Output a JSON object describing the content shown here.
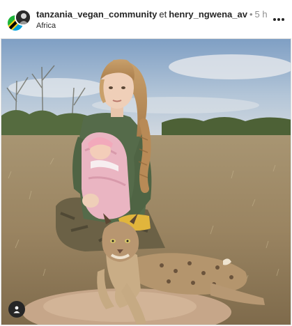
{
  "post": {
    "author_primary": "tanzania_vegan_community",
    "author_joiner": "et",
    "author_secondary": "henry_ngwena_av",
    "separator": "•",
    "age": "5 h",
    "location": "Africa"
  },
  "icons": {
    "more": "more-horizontal-icon",
    "tagged_users": "person-icon",
    "avatar_primary": "tanzania-flag-icon",
    "avatar_secondary": "profile-photo"
  },
  "colors": {
    "text": "#262626",
    "muted": "#8e8e8e",
    "border": "#dbdbdb"
  }
}
